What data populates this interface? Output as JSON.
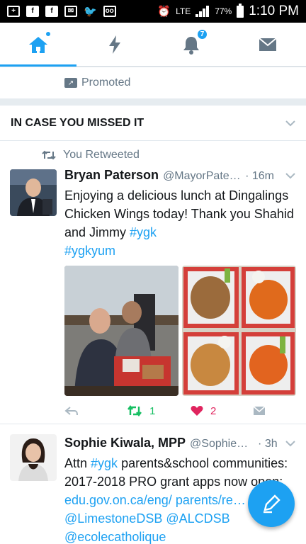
{
  "status_bar": {
    "network": "LTE",
    "battery": "77%",
    "time": "1:10 PM"
  },
  "tabs": {
    "home": {
      "has_dot": true
    },
    "moments": {},
    "notifications": {
      "badge": "7"
    },
    "messages": {}
  },
  "promoted_label": "Promoted",
  "section_title": "IN CASE YOU MISSED IT",
  "tweets": [
    {
      "retweet_context": "You Retweeted",
      "name": "Bryan Paterson",
      "handle": "@MayorPater…",
      "time": "· 16m",
      "text_plain": "Enjoying a delicious lunch at Dingalings Chicken Wings today! Thank you Shahid and Jimmy ",
      "hashtag1": "#ygk",
      "hashtag2": "#ygkyum",
      "retweets": "1",
      "likes": "2"
    },
    {
      "name": "Sophie Kiwala, MPP",
      "handle": "@SophieK…",
      "time": "· 3h",
      "text_a": "Attn ",
      "hashtag": "#ygk",
      "text_b": " parents&school communities: 2017-2018 PRO grant apps now open: ",
      "link1": "edu.gov.on.ca/eng/",
      "link2": "parents/re…",
      "mention1": "@LimestoneDSB",
      "mention2": "@ALCDSB",
      "mention3": "@ecolecatholique"
    }
  ],
  "colors": {
    "accent": "#1da1f2",
    "retweet_green": "#17bf63",
    "like_red": "#e0245e"
  }
}
